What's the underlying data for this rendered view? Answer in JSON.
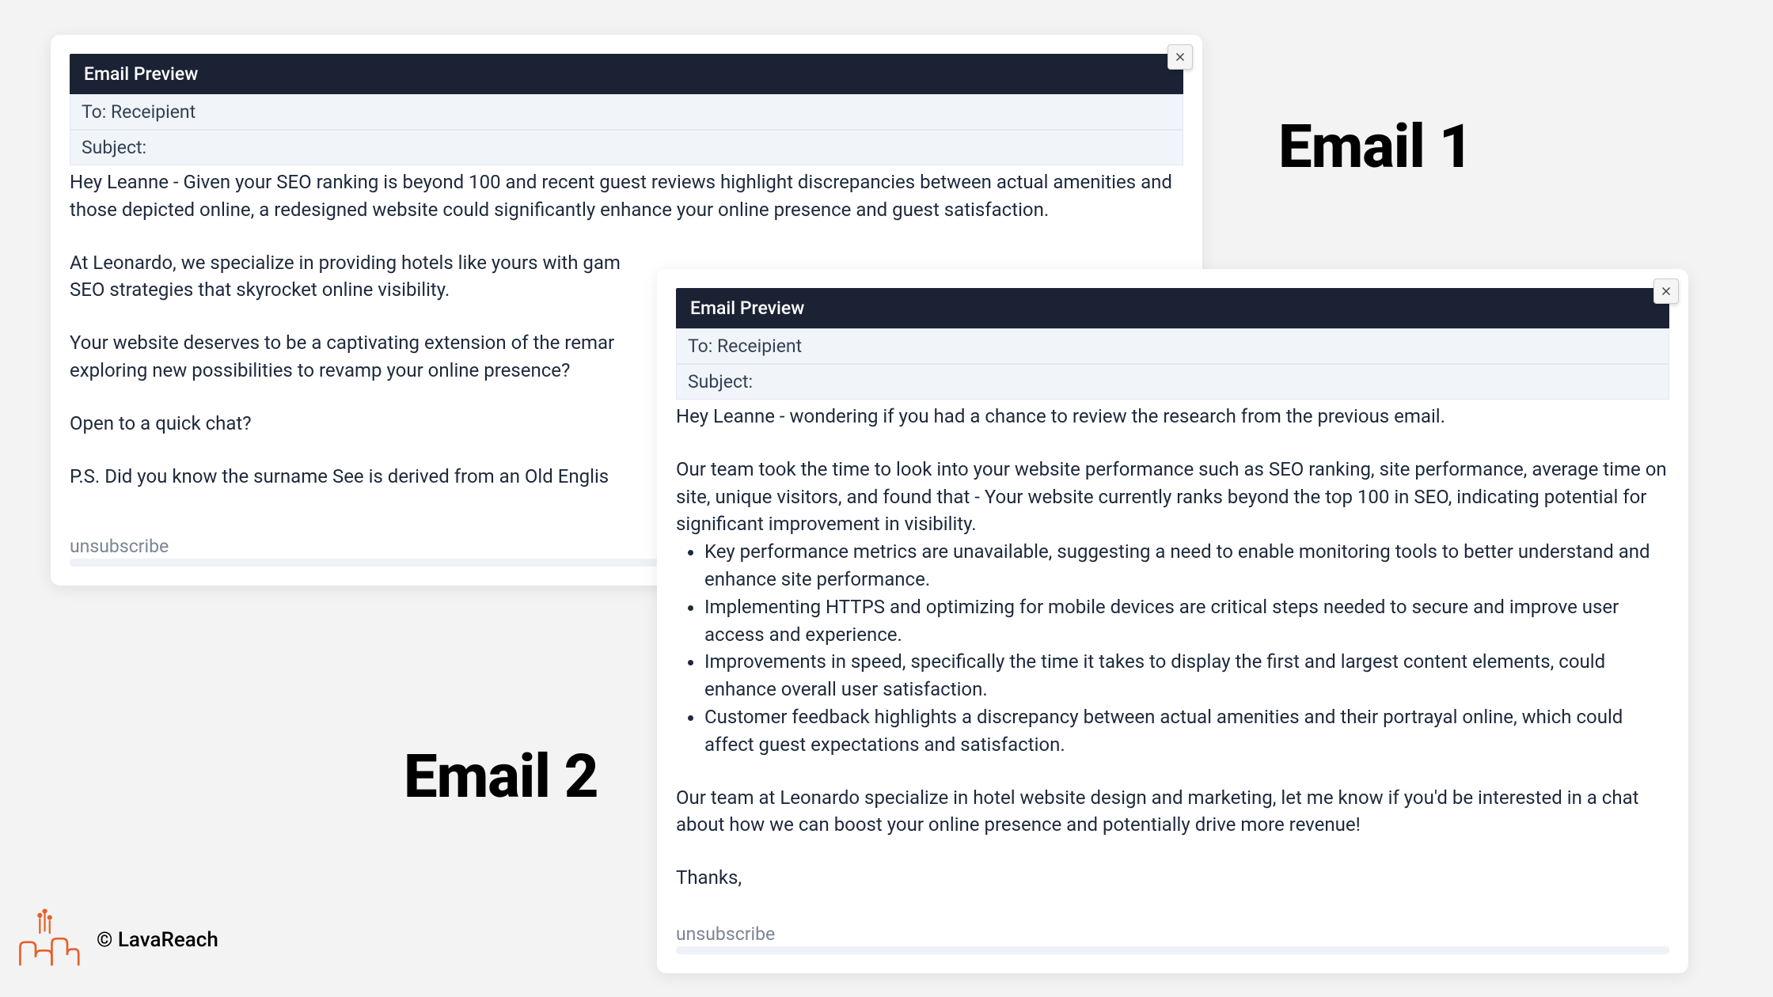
{
  "labels": {
    "email1": "Email 1",
    "email2": "Email 2"
  },
  "footer": {
    "copyright": "© LavaReach"
  },
  "email1": {
    "header": "Email Preview",
    "to": "To: Receipient",
    "subject": "Subject:",
    "body_p1": "Hey Leanne - Given your SEO ranking is beyond 100 and recent guest reviews highlight discrepancies between actual amenities and those depicted online, a redesigned website could significantly enhance your online presence and guest satisfaction.",
    "body_p2": "At Leonardo, we specialize in providing hotels like yours with gam",
    "body_p2b": "SEO strategies that skyrocket online visibility.",
    "body_p3": "Your website deserves to be a captivating extension of the remar",
    "body_p3b": "exploring new possibilities to revamp your online presence?",
    "body_p4": "Open to a quick chat?",
    "body_p5": "P.S. Did you know the surname See is derived from an Old Englis",
    "unsubscribe": "unsubscribe"
  },
  "email2": {
    "header": "Email Preview",
    "to": "To: Receipient",
    "subject": "Subject:",
    "body_p1": "Hey Leanne - wondering if you had a chance to review the research from the previous email.",
    "body_p2": "Our team took the time to look into your website performance such as SEO ranking, site performance, average time on site, unique visitors, and found that - Your website currently ranks beyond the top 100 in SEO, indicating potential for significant improvement in visibility.",
    "bullets": [
      "Key performance metrics are unavailable, suggesting a need to enable monitoring tools to better understand and enhance site performance.",
      "Implementing HTTPS and optimizing for mobile devices are critical steps needed to secure and improve user access and experience.",
      "Improvements in speed, specifically the time it takes to display the first and largest content elements, could enhance overall user satisfaction.",
      "Customer feedback highlights a discrepancy between actual amenities and their portrayal online, which could affect guest expectations and satisfaction."
    ],
    "body_p3": "Our team at Leonardo specialize in hotel website design and marketing, let me know if you'd be interested in a chat about how we can boost your online presence and potentially drive more revenue!",
    "body_p4": "Thanks,",
    "unsubscribe": "unsubscribe"
  }
}
